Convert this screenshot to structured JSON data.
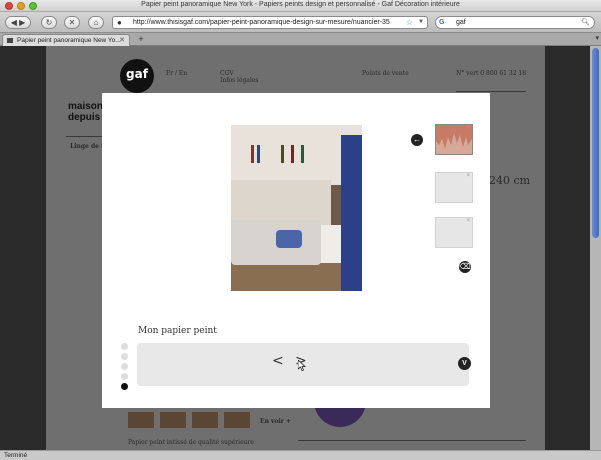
{
  "window": {
    "title": "Papier peint panoramique New York - Papiers peints design et personnalisé - Gaf Décoration intérieure"
  },
  "toolbar": {
    "url": "http://www.thisisgaf.com/papier-peint-panoramique-design-sur-mesure/nuancier-35",
    "search_value": "gaf",
    "search_engine_icon": "google-icon"
  },
  "tabs": [
    {
      "label": "Papier peint panoramique New Yo..."
    }
  ],
  "page": {
    "logo": "gaf",
    "lang": "Fr / En",
    "cgv": "CGV",
    "infos": "Infos légales",
    "points_vente": "Points de vente",
    "phone": "N° vert 0 800 61 32 18",
    "brand_line1": "maison",
    "brand_line2": "depuis",
    "linge": "Linge de ta",
    "size": "240 cm",
    "product_desc": "Papier peint intissé de qualité supérieure",
    "en_voir": "En voir +"
  },
  "modal": {
    "section_title": "Mon papier peint",
    "prev_label": "<",
    "next_label": ">",
    "v_label": "V",
    "back_icon": "arrow-left-icon",
    "trash_icon": "trash-icon",
    "thumb_close": "×"
  },
  "status": {
    "text": "Terminé"
  }
}
